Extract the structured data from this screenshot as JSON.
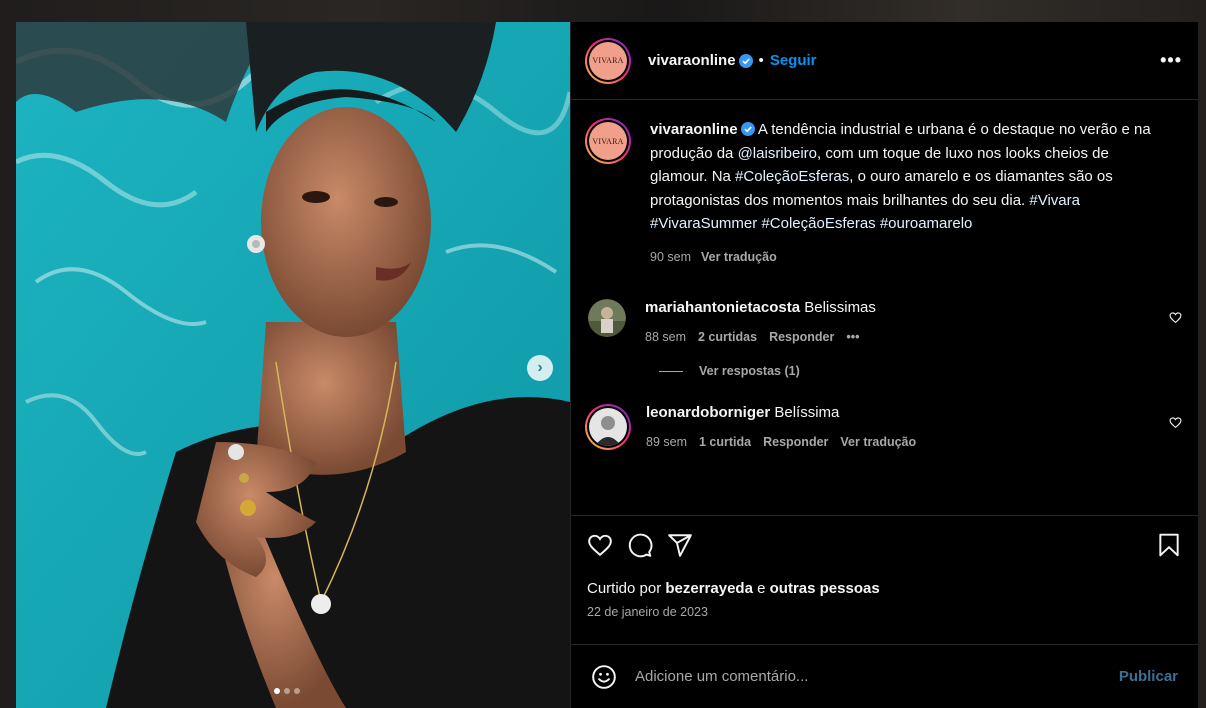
{
  "post": {
    "username": "vivaraonline",
    "avatar_brand": "VIVARA",
    "follow_label": "Seguir",
    "separator": "•",
    "more_label": "•••"
  },
  "caption": {
    "username": "vivaraonline",
    "text_1": "A tendência industrial e urbana é o destaque no verão e na produção da ",
    "mention": "@laisribeiro",
    "text_2": ", com um toque de luxo nos looks cheios de glamour. Na ",
    "tag_1": "#ColeçãoEsferas",
    "text_3": ", o ouro amarelo e os diamantes são os protagonistas dos momentos mais brilhantes do seu dia. ",
    "tag_2": "#Vivara",
    "tag_3": "#VivaraSummer",
    "tag_4": "#ColeçãoEsferas",
    "tag_5": "#ouroamarelo",
    "age": "90 sem",
    "translate": "Ver tradução"
  },
  "comments": [
    {
      "username": "mariahantonietacosta",
      "text": "Belissimas",
      "age": "88 sem",
      "likes": "2 curtidas",
      "reply": "Responder",
      "more": "•••",
      "view_replies": "Ver respostas (1)"
    },
    {
      "username": "leonardoborniger",
      "text": "Belíssima",
      "age": "89 sem",
      "likes": "1 curtida",
      "reply": "Responder",
      "translate": "Ver tradução"
    }
  ],
  "engagement": {
    "liked_prefix": "Curtido por ",
    "liked_user": "bezerrayeda",
    "liked_mid": " e ",
    "liked_others": "outras pessoas",
    "date": "22 de janeiro de 2023"
  },
  "composer": {
    "placeholder": "Adicione um comentário...",
    "publish_label": "Publicar"
  },
  "carousel": {
    "current": 1,
    "total": 3,
    "next_glyph": "›"
  },
  "colors": {
    "link_blue": "#0095f6",
    "publish_disabled": "#3b6f95",
    "verified_blue": "#3897f0"
  }
}
